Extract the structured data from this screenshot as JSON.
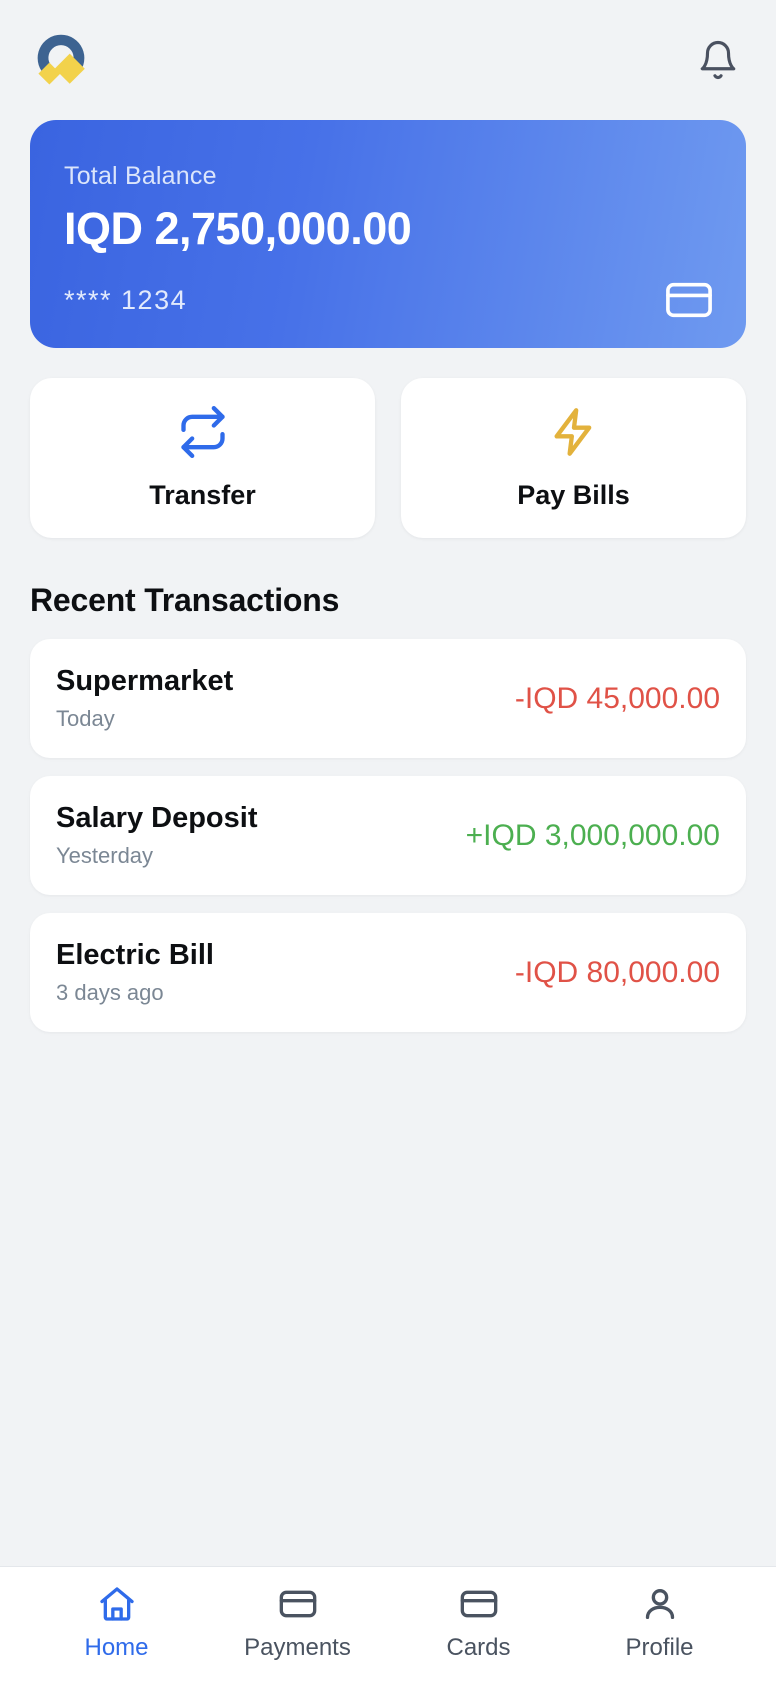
{
  "header": {
    "logo_name": "brand-logo",
    "logo_colors": {
      "ring": "#3d6391",
      "diamond": "#f2d24b"
    },
    "notifications_icon": "bell-icon"
  },
  "balance_card": {
    "label": "Total Balance",
    "amount": "IQD 2,750,000.00",
    "card_mask": "**** 1234",
    "card_icon": "credit-card-icon",
    "gradient_from": "#3a64e0",
    "gradient_to": "#6f9af0"
  },
  "quick_actions": [
    {
      "label": "Transfer",
      "icon": "transfer-arrows-icon",
      "color": "#2f6bea"
    },
    {
      "label": "Pay Bills",
      "icon": "lightning-bolt-icon",
      "color": "#e3b23c"
    }
  ],
  "transactions": {
    "section_title": "Recent Transactions",
    "items": [
      {
        "title": "Supermarket",
        "date": "Today",
        "amount": "-IQD 45,000.00",
        "type": "debit"
      },
      {
        "title": "Salary Deposit",
        "date": "Yesterday",
        "amount": "+IQD 3,000,000.00",
        "type": "credit"
      },
      {
        "title": "Electric Bill",
        "date": "3 days ago",
        "amount": "-IQD 80,000.00",
        "type": "debit"
      }
    ],
    "debit_color": "#e05247",
    "credit_color": "#4caf50"
  },
  "bottom_nav": {
    "active_color": "#2f6bea",
    "inactive_color": "#4a5360",
    "items": [
      {
        "label": "Home",
        "icon": "home-icon",
        "active": true
      },
      {
        "label": "Payments",
        "icon": "credit-card-icon",
        "active": false
      },
      {
        "label": "Cards",
        "icon": "cards-icon",
        "active": false
      },
      {
        "label": "Profile",
        "icon": "person-icon",
        "active": false
      }
    ]
  }
}
